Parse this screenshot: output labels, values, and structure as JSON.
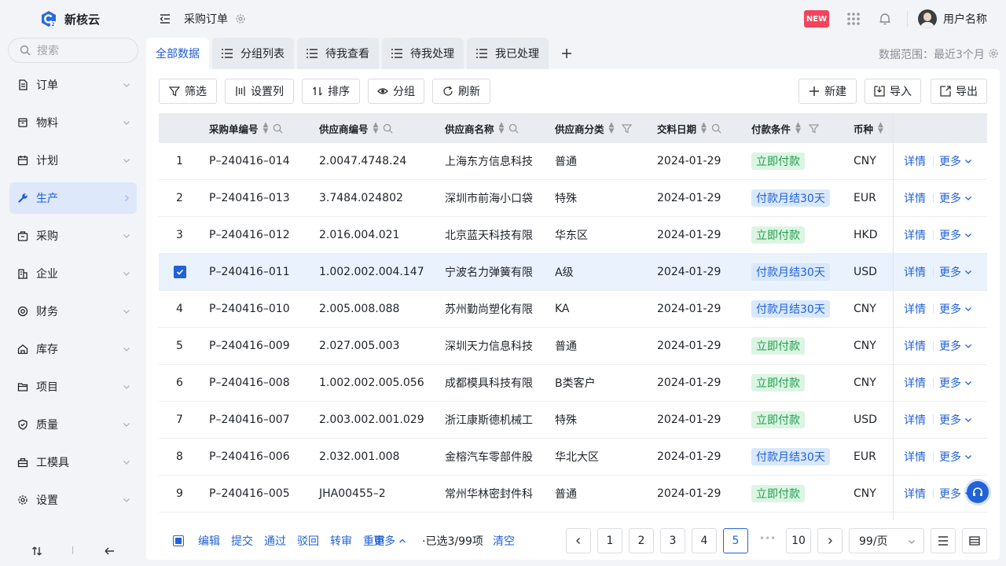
{
  "app": {
    "name": "新核云"
  },
  "sidebar": {
    "search_placeholder": "搜索",
    "items": [
      {
        "label": "订单",
        "icon": "document-icon"
      },
      {
        "label": "物料",
        "icon": "box-icon"
      },
      {
        "label": "计划",
        "icon": "calendar-icon"
      },
      {
        "label": "生产",
        "icon": "wrench-icon",
        "active": true
      },
      {
        "label": "采购",
        "icon": "bag-icon"
      },
      {
        "label": "企业",
        "icon": "building-icon"
      },
      {
        "label": "财务",
        "icon": "coin-icon"
      },
      {
        "label": "库存",
        "icon": "home-icon"
      },
      {
        "label": "项目",
        "icon": "folder-icon"
      },
      {
        "label": "质量",
        "icon": "shield-icon"
      },
      {
        "label": "工模具",
        "icon": "toolbox-icon"
      },
      {
        "label": "设置",
        "icon": "gear-icon"
      }
    ]
  },
  "header": {
    "title": "采购订单",
    "new_badge": "NEW",
    "user_name": "用户名称"
  },
  "tabs": {
    "items": [
      "全部数据",
      "分组列表",
      "待我查看",
      "待我处理",
      "我已处理"
    ],
    "data_range": "数据范围：最近3个月"
  },
  "toolbar": {
    "filter": "筛选",
    "columns": "设置列",
    "sort": "排序",
    "group": "分组",
    "refresh": "刷新",
    "create": "新建",
    "import": "导入",
    "export": "导出"
  },
  "table": {
    "headers": [
      "采购单编号",
      "供应商编号",
      "供应商名称",
      "供应商分类",
      "交料日期",
      "付款条件",
      "币种"
    ],
    "detail_label": "详情",
    "more_label": "更多",
    "rows": [
      {
        "idx": "1",
        "po": "P–240416–014",
        "sup_no": "2.0047.4748.24",
        "sup_name": "上海东方信息科技",
        "cat": "普通",
        "date": "2024-01-29",
        "pay": "立即付款",
        "pay_type": "green",
        "cur": "CNY"
      },
      {
        "idx": "2",
        "po": "P–240416–013",
        "sup_no": "3.7484.024802",
        "sup_name": "深圳市前海小口袋",
        "cat": "特殊",
        "date": "2024-01-29",
        "pay": "付款月结30天",
        "pay_type": "blue",
        "cur": "EUR"
      },
      {
        "idx": "3",
        "po": "P–240416–012",
        "sup_no": "2.016.004.021",
        "sup_name": "北京蓝天科技有限",
        "cat": "华东区",
        "date": "2024-01-29",
        "pay": "立即付款",
        "pay_type": "green",
        "cur": "HKD"
      },
      {
        "idx": "",
        "po": "P–240416–011",
        "sup_no": "1.002.002.004.147",
        "sup_name": "宁波名力弹簧有限",
        "cat": "A级",
        "date": "2024-01-29",
        "pay": "付款月结30天",
        "pay_type": "blue",
        "cur": "USD",
        "selected": true
      },
      {
        "idx": "4",
        "po": "P–240416–010",
        "sup_no": "2.005.008.088",
        "sup_name": "苏州勤尚塑化有限",
        "cat": "KA",
        "date": "2024-01-29",
        "pay": "付款月结30天",
        "pay_type": "blue",
        "cur": "CNY"
      },
      {
        "idx": "5",
        "po": "P–240416–009",
        "sup_no": "2.027.005.003",
        "sup_name": "深圳天力信息科技",
        "cat": "普通",
        "date": "2024-01-29",
        "pay": "立即付款",
        "pay_type": "green",
        "cur": "CNY"
      },
      {
        "idx": "6",
        "po": "P–240416–008",
        "sup_no": "1.002.002.005.056",
        "sup_name": "成都模具科技有限",
        "cat": "B类客户",
        "date": "2024-01-29",
        "pay": "立即付款",
        "pay_type": "green",
        "cur": "CNY"
      },
      {
        "idx": "7",
        "po": "P–240416–007",
        "sup_no": "2.003.002.001.029",
        "sup_name": "浙江康斯德机械工",
        "cat": "特殊",
        "date": "2024-01-29",
        "pay": "立即付款",
        "pay_type": "green",
        "cur": "USD"
      },
      {
        "idx": "8",
        "po": "P–240416–006",
        "sup_no": "2.032.001.008",
        "sup_name": "金榕汽车零部件股",
        "cat": "华北大区",
        "date": "2024-01-29",
        "pay": "付款月结30天",
        "pay_type": "blue",
        "cur": "EUR"
      },
      {
        "idx": "9",
        "po": "P–240416–005",
        "sup_no": "JHA00455–2",
        "sup_name": "常州华林密封件科",
        "cat": "普通",
        "date": "2024-01-29",
        "pay": "立即付款",
        "pay_type": "green",
        "cur": "CNY"
      }
    ]
  },
  "footer": {
    "actions": [
      "编辑",
      "提交",
      "通过",
      "驳回",
      "转审",
      "重审"
    ],
    "more": "更多",
    "selected_text": "·已选3/99项",
    "clear": "清空",
    "pages": [
      "1",
      "2",
      "3",
      "4",
      "5"
    ],
    "current_page": "5",
    "ellipsis": "•••",
    "last_page": "10",
    "page_size": "99/页"
  },
  "colors": {
    "accent": "#2162d8",
    "active_bg": "#dde8fb",
    "new_badge": "#f2445b"
  }
}
